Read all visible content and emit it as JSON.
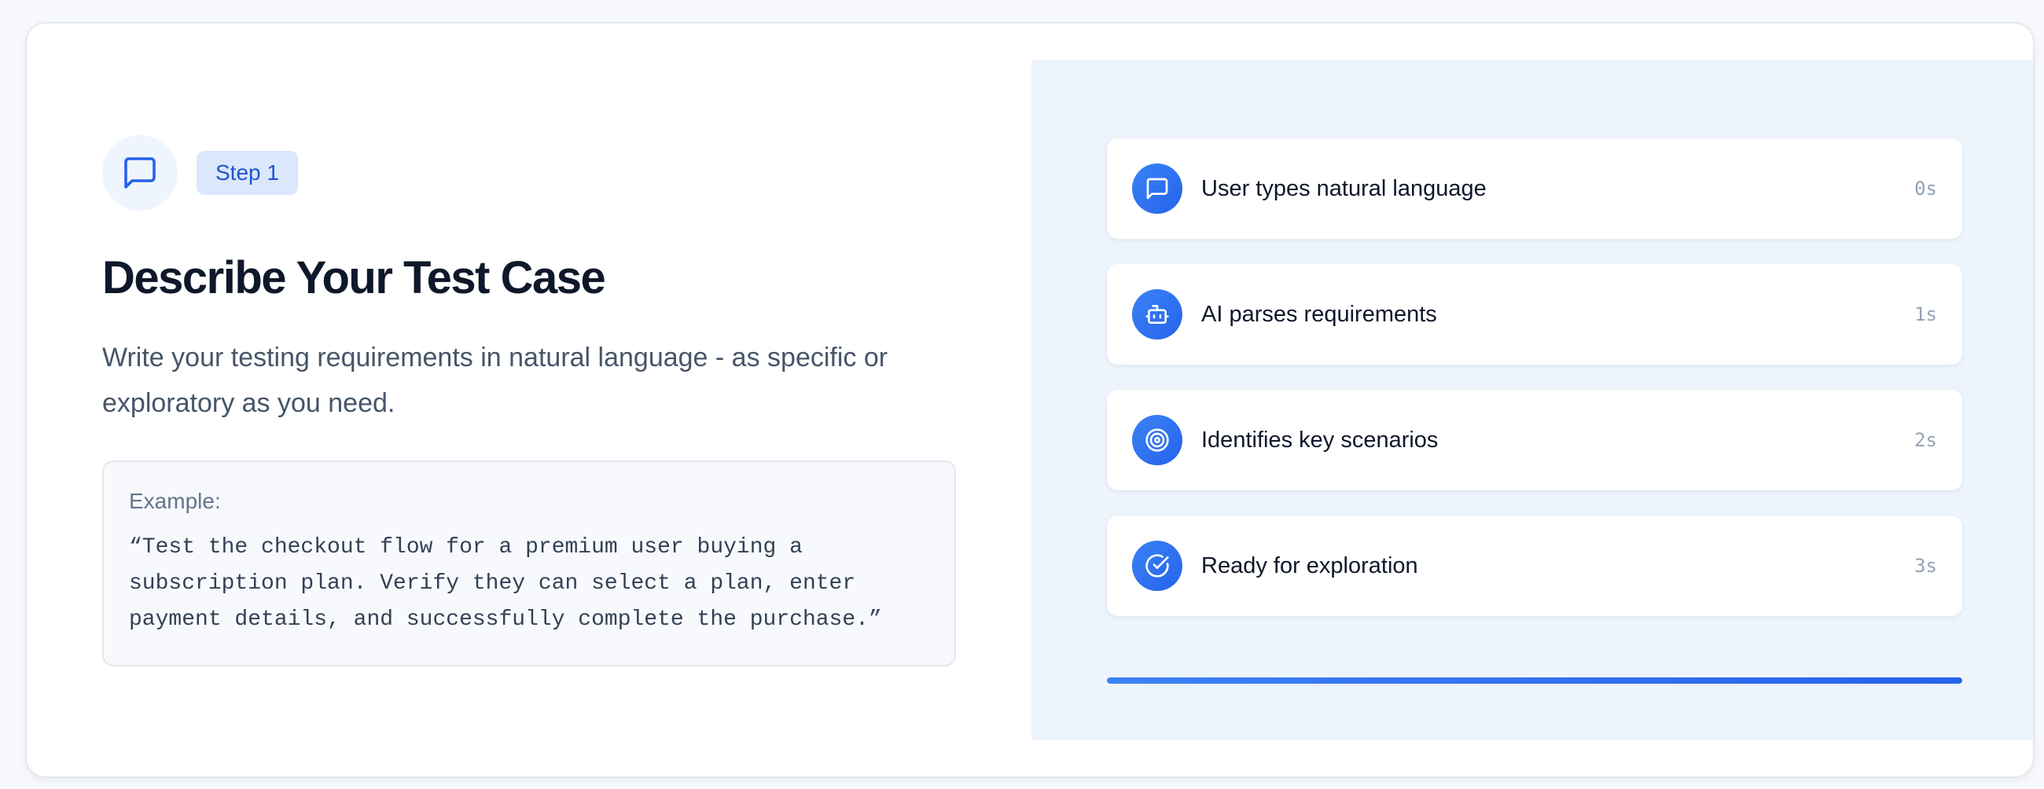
{
  "step": {
    "icon": "message-square-icon",
    "badge_label": "Step 1",
    "title": "Describe Your Test Case",
    "subtitle": "Write your testing requirements in natural language - as specific or exploratory as you need."
  },
  "example": {
    "label": "Example:",
    "text": "“Test the checkout flow for a premium user buying a subscription plan. Verify they can select a plan, enter payment details, and successfully complete the purchase.”"
  },
  "pipeline": {
    "items": [
      {
        "icon": "message-square-icon",
        "label": "User types natural language",
        "time": "0s"
      },
      {
        "icon": "bot-icon",
        "label": "AI parses requirements",
        "time": "1s"
      },
      {
        "icon": "target-icon",
        "label": "Identifies key scenarios",
        "time": "2s"
      },
      {
        "icon": "check-circle-icon",
        "label": "Ready for exploration",
        "time": "3s"
      }
    ],
    "progress": 1.0
  },
  "colors": {
    "accent": "#2563eb",
    "badge_bg": "#dbe8fb",
    "panel_bg": "#eef4fc",
    "title": "#0f172a"
  }
}
